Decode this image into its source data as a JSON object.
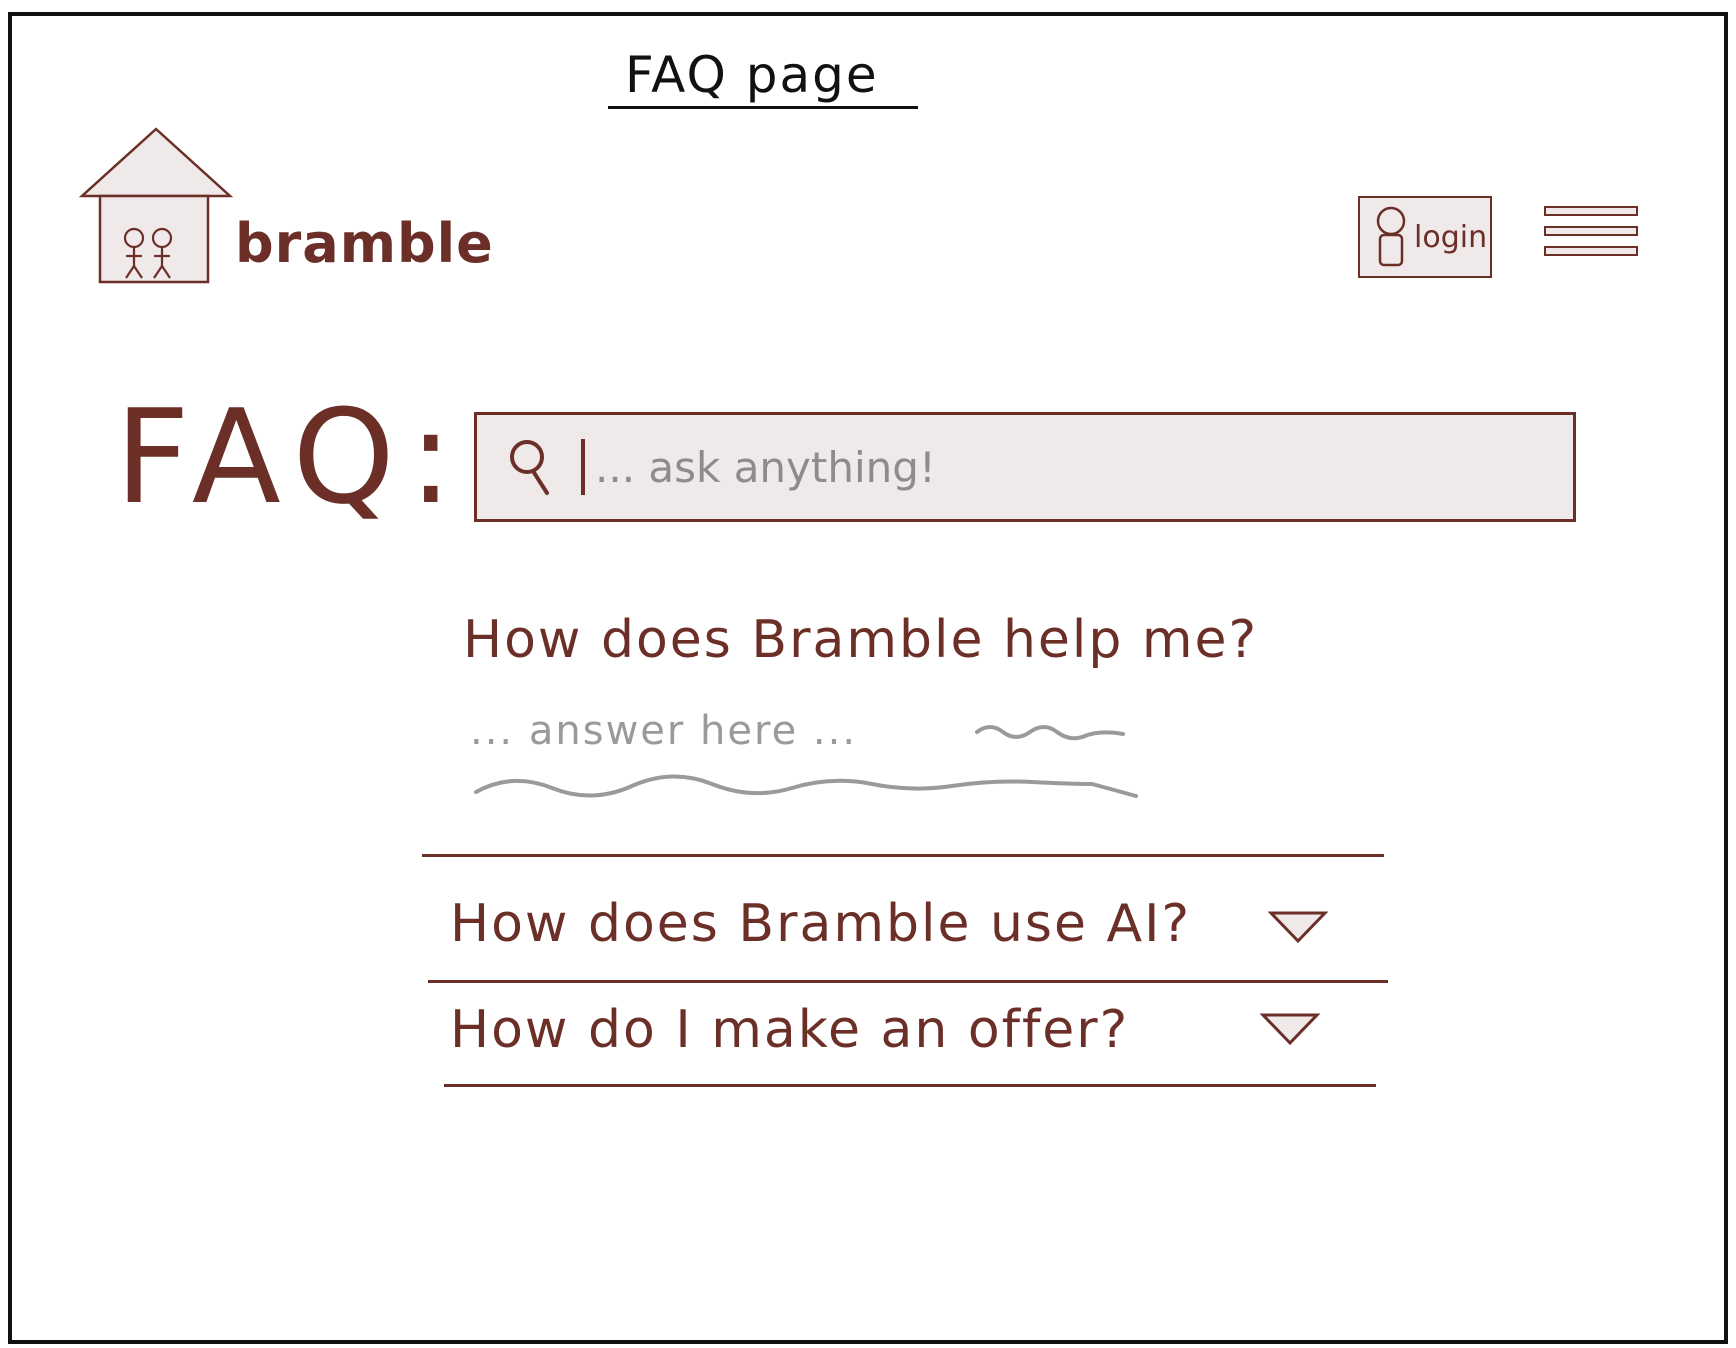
{
  "page_caption": "FAQ page",
  "brand": {
    "name": "bramble"
  },
  "header": {
    "login_label": "login"
  },
  "faq": {
    "heading": "FAQ:",
    "search": {
      "placeholder": "... ask anything!"
    },
    "expanded": {
      "question": "How does Bramble help me?",
      "answer": "... answer here ..."
    },
    "collapsed": [
      {
        "question": "How does Bramble use AI?"
      },
      {
        "question": "How do I make an offer?"
      }
    ]
  },
  "colors": {
    "ink": "#6b2f28",
    "fill": "#efe9e9",
    "muted": "#9a9a9a"
  }
}
